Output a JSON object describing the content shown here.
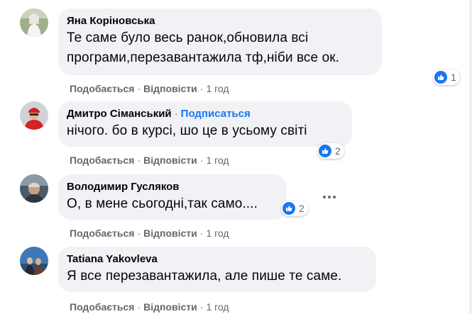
{
  "comments": [
    {
      "author": "Яна Коріновська",
      "lines": [
        "Те саме було весь ранок,обновила всі",
        "програми,перезавантажила тф,ніби все ок."
      ],
      "like_label": "Подобається",
      "reply_label": "Відповісти",
      "time": "1 год",
      "reactions": "1"
    },
    {
      "author": "Дмитро Сіманський",
      "follow_label": "Подписаться",
      "lines": [
        "нічого. бо в курсі, шо це в усьому світі"
      ],
      "like_label": "Подобається",
      "reply_label": "Відповісти",
      "time": "1 год",
      "reactions": "2"
    },
    {
      "author": "Володимир Гусляков",
      "lines": [
        "О, в мене сьогодні,так само...."
      ],
      "like_label": "Подобається",
      "reply_label": "Відповісти",
      "time": "1 год",
      "reactions": "2"
    },
    {
      "author": "Tatiana Yakovleva",
      "lines": [
        "Я все перезавантажила, але пише те саме."
      ],
      "like_label": "Подобається",
      "reply_label": "Відповісти",
      "time": "1 год"
    }
  ],
  "separator": "·",
  "colors": {
    "bubble": "#f0f2f5",
    "link": "#1877f2",
    "secondary_text": "#65676b",
    "like_badge": "#1877f2"
  }
}
